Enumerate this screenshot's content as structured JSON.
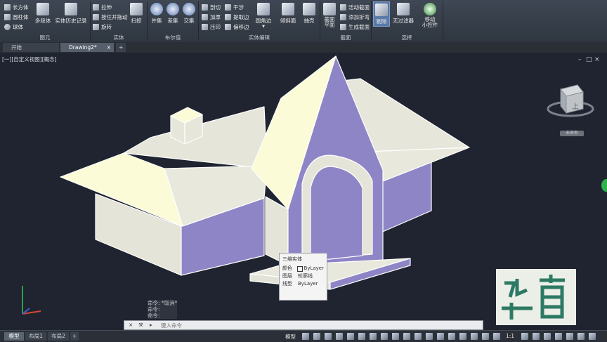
{
  "ribbon": {
    "primitives": {
      "box": "长方体",
      "cylinder": "圆柱体",
      "sphere": "球体",
      "polysolid": "多段体",
      "group": "图元"
    },
    "solid_history": "实体历史记录",
    "solid": {
      "extrude": "拉伸",
      "presspull": "按住并拖动",
      "revolve": "旋转",
      "sweep": "扫掠",
      "group": "实体"
    },
    "boolean": {
      "union": "并集",
      "subtract": "差集",
      "intersect": "交集",
      "group": "布尔值"
    },
    "solid_edit": {
      "slice": "剖切",
      "thicken": "加厚",
      "imprint": "压印",
      "interfere": "干涉",
      "extract_edges": "提取边",
      "offset_edge": "偏移边",
      "fillet_edge": "圆角边",
      "fillet_arrow": "▼",
      "taper": "倾斜面",
      "extract": "抽壳",
      "group": "实体编辑"
    },
    "section": {
      "plane": "截面\n平面",
      "live": "活动截面",
      "add_jog": "添加折弯",
      "generate": "生成截面",
      "group": "截面"
    },
    "selection": {
      "cull": "剔除",
      "no_filter": "无过滤器",
      "gizmo": "移动\n小控件",
      "group": "选择"
    }
  },
  "tabs": {
    "start": "开始",
    "drawing": "Drawing2*",
    "close_icon": "×",
    "add_icon": "+"
  },
  "viewport": {
    "label": "[一][自定义视图][概念]",
    "viewcube_face": "上",
    "wcs": "未命名",
    "window_buttons": {
      "min": "–",
      "max": "□",
      "close": "×"
    }
  },
  "properties_popup": {
    "title": "三维实体",
    "rows": [
      {
        "key": "颜色",
        "value": "ByLayer"
      },
      {
        "key": "图层",
        "value": "轮廓线"
      },
      {
        "key": "线型",
        "value": "ByLayer"
      }
    ]
  },
  "command": {
    "history": [
      "命令: *取消*",
      "命令:",
      "命令:"
    ],
    "placeholder": "键入命令"
  },
  "layout_tabs": [
    "模型",
    "布局1",
    "布局2"
  ],
  "status": {
    "model": "模型",
    "scale": "1:1"
  },
  "logo": {
    "text": "华育"
  },
  "colors": {
    "roof": "#fbfbd7",
    "wall": "#e4e4d9",
    "shade": "#8e85c6",
    "bg": "#1f2430",
    "logo": "#2d7a64"
  }
}
